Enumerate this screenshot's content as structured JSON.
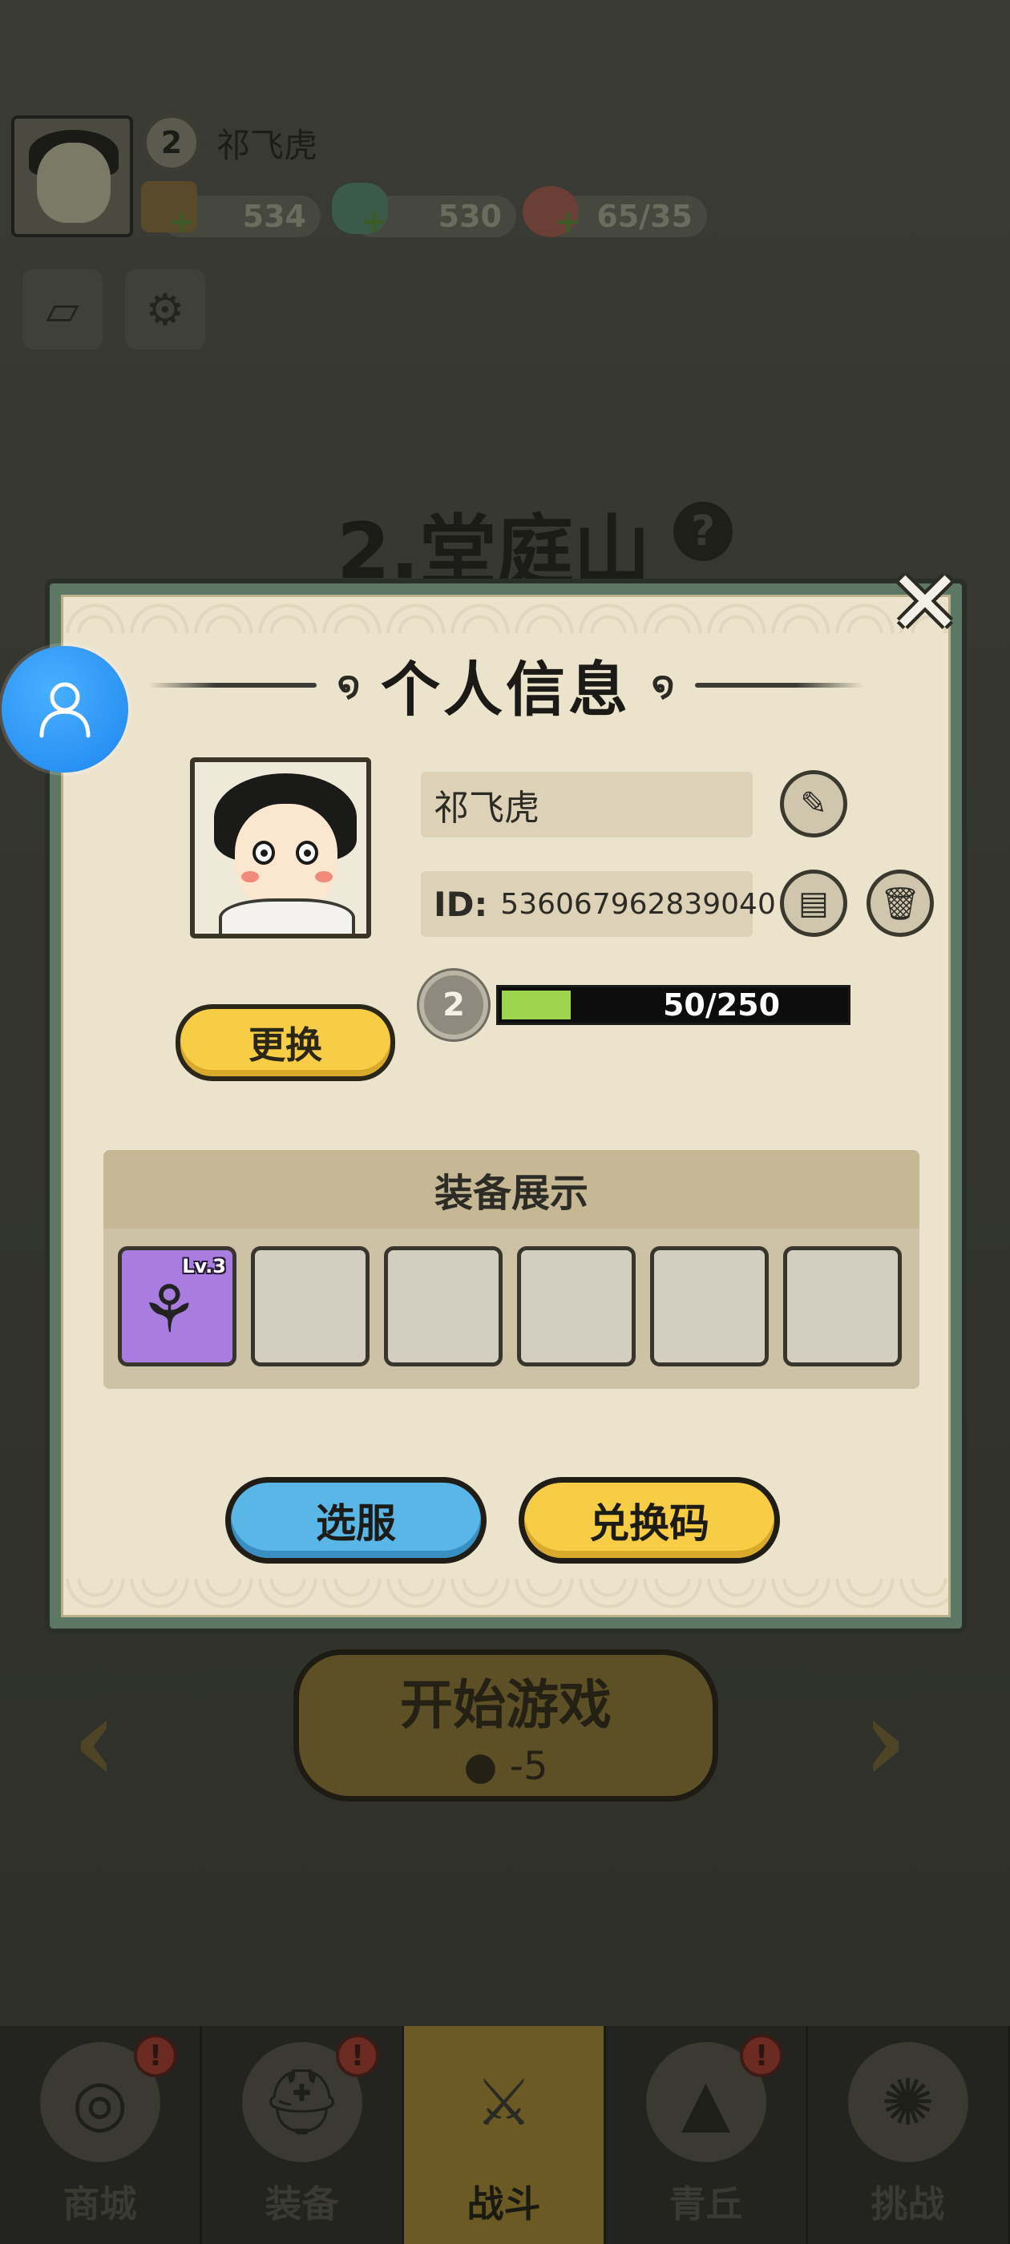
{
  "background": {
    "player_level": "2",
    "player_name": "祁飞虎",
    "resources": [
      {
        "name": "gold",
        "value": "534"
      },
      {
        "name": "jade",
        "value": "530"
      },
      {
        "name": "peach-stamina",
        "value": "65/35"
      }
    ],
    "stage_title": "2.堂庭山",
    "start_button": {
      "label": "开始游戏",
      "cost": "-5"
    },
    "nav_tabs": [
      {
        "label": "商城",
        "icon": "shop-icon",
        "badge": "!"
      },
      {
        "label": "装备",
        "icon": "helmet-icon",
        "badge": "!"
      },
      {
        "label": "战斗",
        "icon": "crossed-swords-icon",
        "badge": ""
      },
      {
        "label": "青丘",
        "icon": "mountain-icon",
        "badge": "!"
      },
      {
        "label": "挑战",
        "icon": "challenge-icon",
        "badge": ""
      }
    ],
    "active_tab": "战斗"
  },
  "modal": {
    "title": "个人信息",
    "close_label": "✕",
    "player_name": "祁飞虎",
    "id_label": "ID:",
    "id_value": "536067962839040",
    "level": "2",
    "exp_text": "50/250",
    "exp_fraction": 0.2,
    "change_avatar_label": "更换",
    "equipment_title": "装备展示",
    "equipment_slots": [
      {
        "filled": true,
        "level": "Lv.3",
        "icon": "flower-staff-icon"
      },
      {
        "filled": false,
        "level": "",
        "icon": ""
      },
      {
        "filled": false,
        "level": "",
        "icon": ""
      },
      {
        "filled": false,
        "level": "",
        "icon": ""
      },
      {
        "filled": false,
        "level": "",
        "icon": ""
      },
      {
        "filled": false,
        "level": "",
        "icon": ""
      }
    ],
    "select_server_label": "选服",
    "redeem_code_label": "兑换码"
  },
  "colors": {
    "accent_yellow": "#f6cd45",
    "accent_blue": "#59b6e6",
    "exp_green": "#9ed34e",
    "modal_border_green": "#5c7864",
    "paper": "#ece3cc",
    "float_button_blue": "#1e86ef"
  }
}
